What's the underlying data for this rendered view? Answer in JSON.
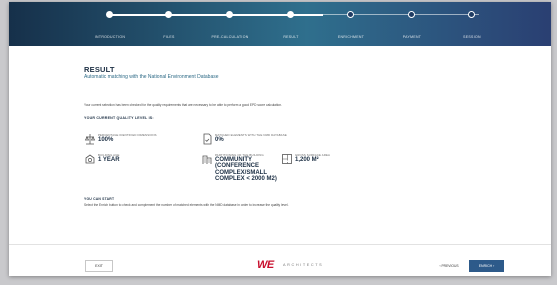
{
  "stepper": {
    "steps": [
      {
        "label": "Introduction",
        "state": "done"
      },
      {
        "label": "Files",
        "state": "done"
      },
      {
        "label": "Pre-calculation",
        "state": "done"
      },
      {
        "label": "Result",
        "state": "current"
      },
      {
        "label": "Enrichment",
        "state": "pending"
      },
      {
        "label": "Payment",
        "state": "pending"
      },
      {
        "label": "Session",
        "state": "pending"
      }
    ]
  },
  "page": {
    "title": "RESULT",
    "subtitle": "Automatic matching with the National Environment Database",
    "intro": "Your current selection has been checked for the quality requirements that are necessary to be able to perform a good EPD score calculation.",
    "quality_heading": "YOUR CURRENT QUALITY LEVEL IS:"
  },
  "metrics": [
    {
      "label": "PERCENTAGE IDENTIFIED DIMENSIONS",
      "value": "100%",
      "icon": "scale-icon"
    },
    {
      "label": "MATCHED ELEMENTS WITH THE NMD DATABASE",
      "value": "0%",
      "icon": "document-check-icon"
    },
    {
      "label": "BUILDING AGE",
      "value": "1 YEAR",
      "icon": "building-age-icon"
    },
    {
      "label": "PARTITIONING OF THE BUILDING",
      "value": "COMMUNITY (CONFERENCE COMPLEX/SMALL COMPLEX < 2000 M2)",
      "icon": "building-icon"
    },
    {
      "label": "GROSS SURFACE AREA",
      "value": "1,200 M²",
      "icon": "floor-plan-icon"
    }
  ],
  "start": {
    "heading": "YOU CAN START",
    "text": "Select the Enrich button to check and complement the number of matched elements with the NMD database in order to increase the quality level."
  },
  "footer": {
    "exit_label": "EXIT",
    "brand_text": "ARCHITECTS",
    "previous_label": "PREVIOUS",
    "enrich_label": "ENRICH"
  },
  "colors": {
    "accent": "#2d5a8a",
    "brand_red": "#c8102e",
    "header_dark": "#16304a"
  }
}
